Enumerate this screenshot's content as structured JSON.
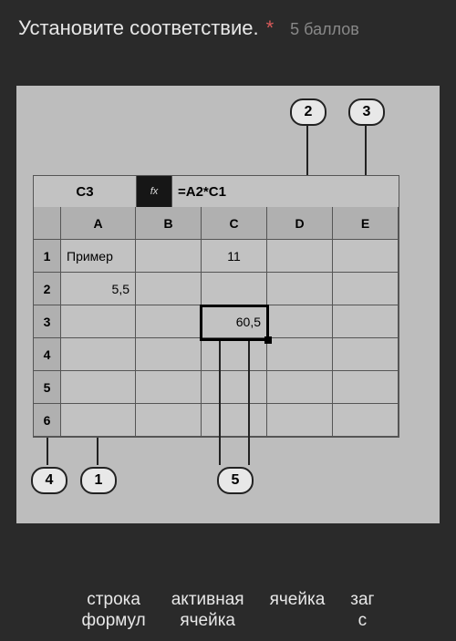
{
  "header": {
    "title": "Установите соответствие.",
    "asterisk": "*",
    "points": "5 баллов"
  },
  "callouts": {
    "c1": "1",
    "c2": "2",
    "c3": "3",
    "c4": "4",
    "c5": "5"
  },
  "spreadsheet": {
    "name_box": "C3",
    "fx_label": "fx",
    "formula": "=A2*C1",
    "columns": [
      "A",
      "B",
      "C",
      "D",
      "E"
    ],
    "rows": [
      "1",
      "2",
      "3",
      "4",
      "5",
      "6"
    ],
    "cells": {
      "A1": "Пример",
      "C1": "11",
      "A2": "5,5",
      "C3": "60,5"
    }
  },
  "answers": {
    "a1": "строка\nформул",
    "a2": "активная\nячейка",
    "a3": "ячейка",
    "a4": "заг\nс"
  }
}
